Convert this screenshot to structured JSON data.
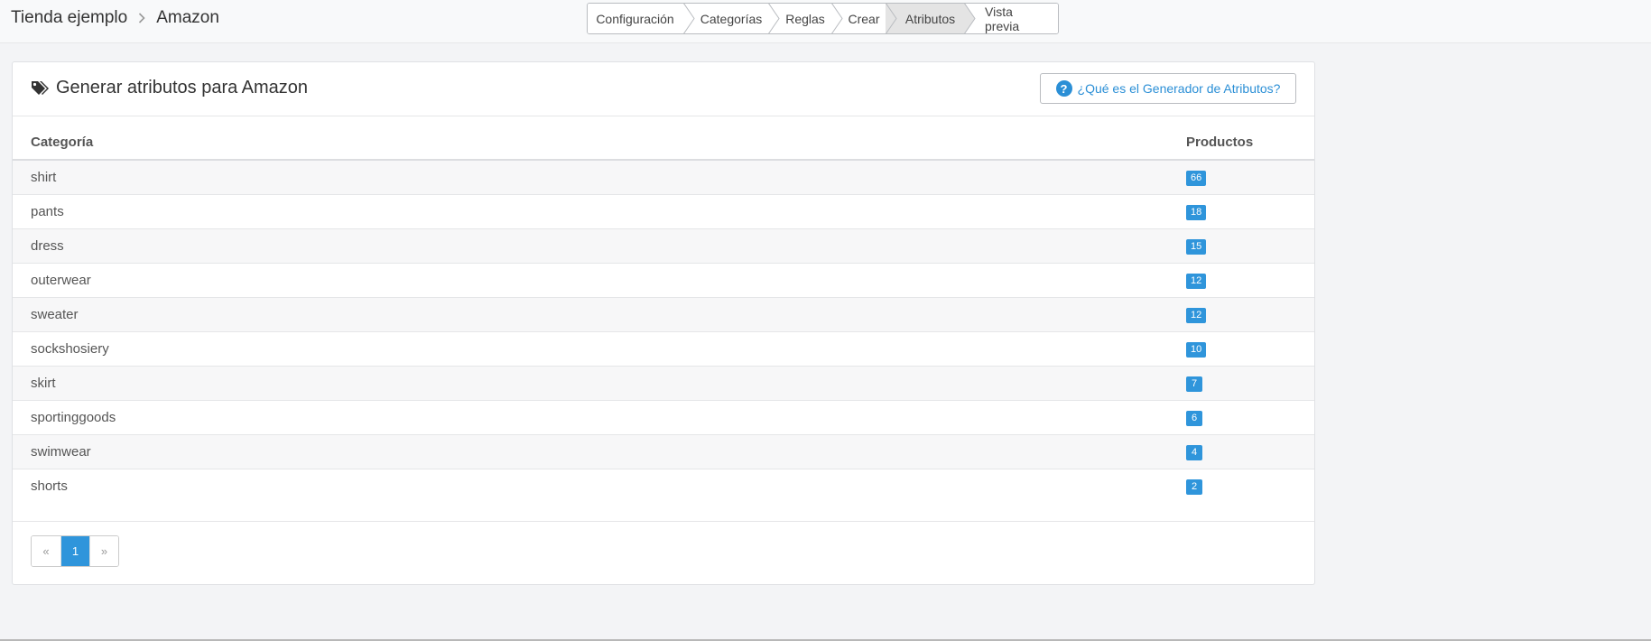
{
  "breadcrumb": {
    "store": "Tienda ejemplo",
    "channel": "Amazon"
  },
  "wizard": {
    "steps": [
      "Configuración",
      "Categorías",
      "Reglas",
      "Crear",
      "Atributos",
      "Vista previa"
    ],
    "active": "Atributos"
  },
  "card": {
    "title": "Generar atributos para Amazon",
    "help_button": "¿Qué es el Generador de Atributos?"
  },
  "table": {
    "headers": {
      "category": "Categoría",
      "products": "Productos"
    },
    "rows": [
      {
        "category": "shirt",
        "products": "66"
      },
      {
        "category": "pants",
        "products": "18"
      },
      {
        "category": "dress",
        "products": "15"
      },
      {
        "category": "outerwear",
        "products": "12"
      },
      {
        "category": "sweater",
        "products": "12"
      },
      {
        "category": "sockshosiery",
        "products": "10"
      },
      {
        "category": "skirt",
        "products": "7"
      },
      {
        "category": "sportinggoods",
        "products": "6"
      },
      {
        "category": "swimwear",
        "products": "4"
      },
      {
        "category": "shorts",
        "products": "2"
      }
    ]
  },
  "pagination": {
    "prev": "«",
    "current": "1",
    "next": "»"
  },
  "colors": {
    "accent": "#2f95db",
    "link": "#2b8fd6",
    "active_step": "#e4e4e4"
  }
}
